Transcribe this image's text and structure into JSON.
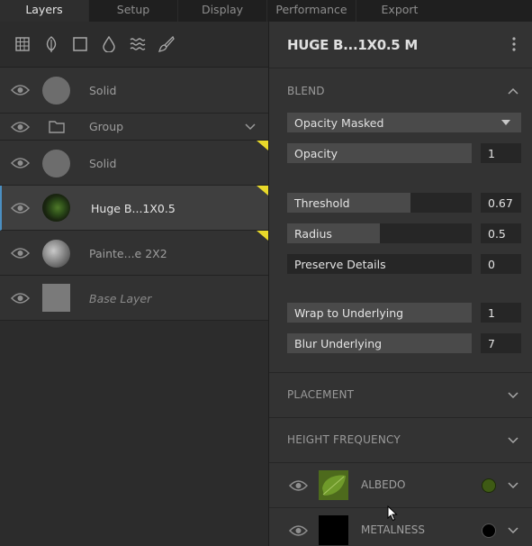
{
  "tabs": [
    "Layers",
    "Setup",
    "Display",
    "Performance",
    "Export"
  ],
  "active_tab": "Layers",
  "toolbar_icons": [
    "grid-icon",
    "leaf-icon",
    "square-icon",
    "drop-icon",
    "waves-icon",
    "brush-icon"
  ],
  "layers": [
    {
      "name": "Solid",
      "thumb": "gray-circle"
    },
    {
      "name": "Group",
      "thumb": "folder"
    },
    {
      "name": "Solid",
      "thumb": "gray-circle"
    },
    {
      "name": "Huge B...1X0.5",
      "thumb": "moss",
      "selected": true
    },
    {
      "name": "Painte...e 2X2",
      "thumb": "stone"
    },
    {
      "name": "Base Layer",
      "thumb": "gray-square"
    }
  ],
  "panel": {
    "title": "HUGE B...1X0.5 M",
    "blend": {
      "header": "BLEND",
      "mode": "Opacity Masked",
      "params": [
        {
          "label": "Opacity",
          "value": "1",
          "fill": 1.0
        },
        {
          "label": "Threshold",
          "value": "0.67",
          "fill": 0.67
        },
        {
          "label": "Radius",
          "value": "0.5",
          "fill": 0.5
        },
        {
          "label": "Preserve Details",
          "value": "0",
          "fill": 0.0
        },
        {
          "label": "Wrap to Underlying",
          "value": "1",
          "fill": 1.0
        },
        {
          "label": "Blur Underlying",
          "value": "7",
          "fill": 1.0
        }
      ]
    },
    "placement": "PLACEMENT",
    "height_frequency": "HEIGHT FREQUENCY",
    "channels": [
      {
        "label": "ALBEDO",
        "color": "#3e5a14"
      },
      {
        "label": "METALNESS",
        "color": "#000000"
      }
    ]
  },
  "colors": {
    "accent": "#4b8fc2",
    "warning_corner": "#e8d92a"
  }
}
